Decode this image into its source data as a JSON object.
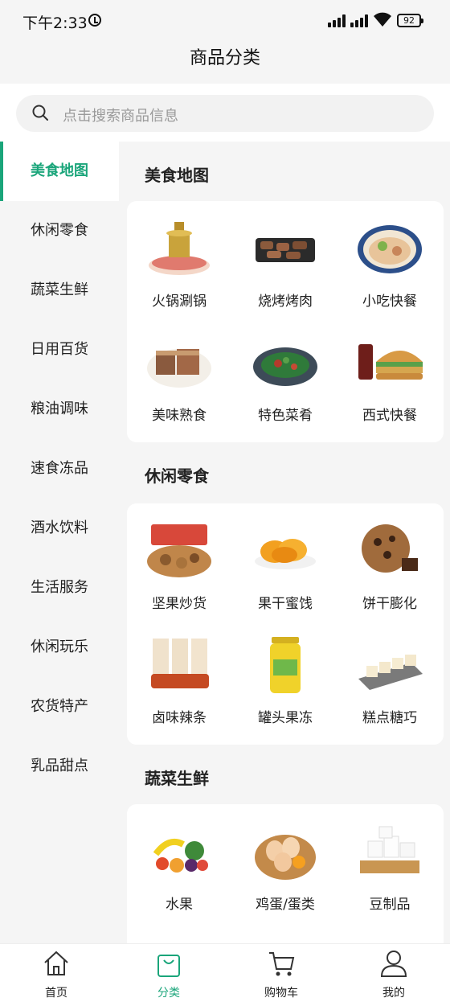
{
  "status_bar": {
    "time": "下午2:33",
    "battery": "92"
  },
  "header": {
    "title": "商品分类"
  },
  "search": {
    "placeholder": "点击搜索商品信息"
  },
  "sidebar": {
    "items": [
      {
        "label": "美食地图",
        "active": true
      },
      {
        "label": "休闲零食"
      },
      {
        "label": "蔬菜生鲜"
      },
      {
        "label": "日用百货"
      },
      {
        "label": "粮油调味"
      },
      {
        "label": "速食冻品"
      },
      {
        "label": "酒水饮料"
      },
      {
        "label": "生活服务"
      },
      {
        "label": "休闲玩乐"
      },
      {
        "label": "农货特产"
      },
      {
        "label": "乳品甜点"
      }
    ]
  },
  "sections": [
    {
      "title": "美食地图",
      "items": [
        {
          "label": "火锅涮锅",
          "icon": "hotpot-icon"
        },
        {
          "label": "烧烤烤肉",
          "icon": "bbq-grill-icon"
        },
        {
          "label": "小吃快餐",
          "icon": "noodle-bowl-icon"
        },
        {
          "label": "美味熟食",
          "icon": "cooked-meat-icon"
        },
        {
          "label": "特色菜肴",
          "icon": "dish-plate-icon"
        },
        {
          "label": "西式快餐",
          "icon": "burger-icon"
        }
      ]
    },
    {
      "title": "休闲零食",
      "items": [
        {
          "label": "坚果炒货",
          "icon": "nuts-icon"
        },
        {
          "label": "果干蜜饯",
          "icon": "dried-fruit-icon"
        },
        {
          "label": "饼干膨化",
          "icon": "cookie-icon"
        },
        {
          "label": "卤味辣条",
          "icon": "spicy-strips-icon"
        },
        {
          "label": "罐头果冻",
          "icon": "canned-jar-icon"
        },
        {
          "label": "糕点糖巧",
          "icon": "pastry-icon"
        }
      ]
    },
    {
      "title": "蔬菜生鲜",
      "items": [
        {
          "label": "水果",
          "icon": "fruit-icon"
        },
        {
          "label": "鸡蛋/蛋类",
          "icon": "eggs-icon"
        },
        {
          "label": "豆制品",
          "icon": "tofu-icon"
        }
      ]
    }
  ],
  "tabbar": {
    "items": [
      {
        "label": "首页",
        "icon": "home-icon"
      },
      {
        "label": "分类",
        "icon": "category-bag-icon",
        "active": true
      },
      {
        "label": "购物车",
        "icon": "cart-icon"
      },
      {
        "label": "我的",
        "icon": "user-icon"
      }
    ]
  },
  "colors": {
    "accent": "#1aa57a"
  }
}
